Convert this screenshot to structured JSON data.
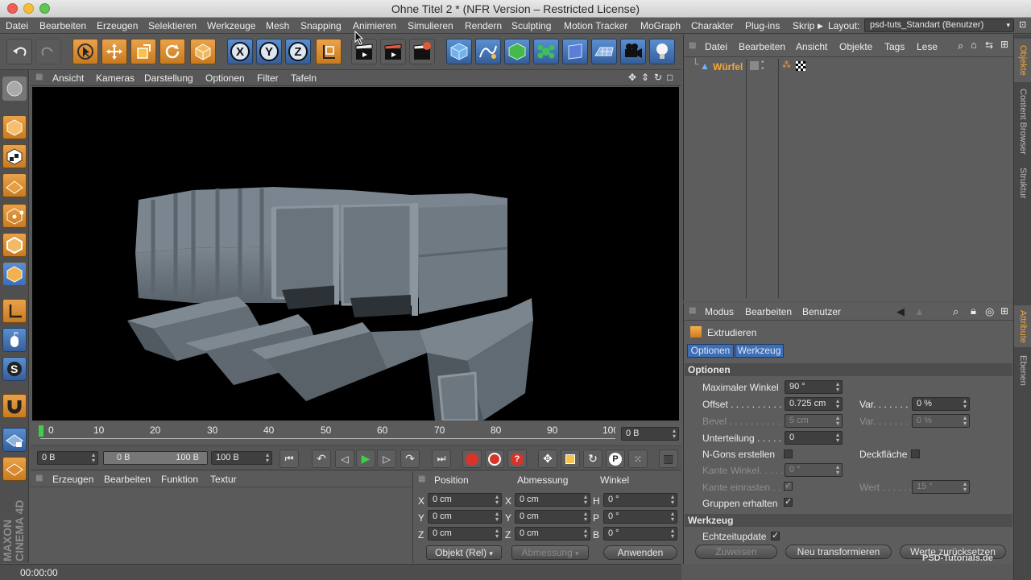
{
  "window": {
    "title": "Ohne Titel 2 * (NFR Version – Restricted License)"
  },
  "menubar": {
    "items": [
      "Datei",
      "Bearbeiten",
      "Erzeugen",
      "Selektieren",
      "Werkzeuge",
      "Mesh",
      "Snapping",
      "Animieren",
      "Simulieren",
      "Rendern",
      "Sculpting",
      "Motion Tracker",
      "MoGraph",
      "Charakter",
      "Plug-ins",
      "Skrip"
    ],
    "layout_label": "Layout:",
    "layout_value": "psd-tuts_Standart (Benutzer)"
  },
  "toolbar": {
    "axis_x": "X",
    "axis_y": "Y",
    "axis_z": "Z"
  },
  "viewport": {
    "menu": [
      "Ansicht",
      "Kameras",
      "Darstellung",
      "Optionen",
      "Filter",
      "Tafeln"
    ]
  },
  "timeline": {
    "ticks": [
      "0",
      "10",
      "20",
      "30",
      "40",
      "50",
      "60",
      "70",
      "80",
      "90",
      "100"
    ],
    "current_frame": "0 B"
  },
  "transport": {
    "start_field": "0 B",
    "range_start": "0 B",
    "range_end": "100 B",
    "end_field": "100 B"
  },
  "materials": {
    "menu": [
      "Erzeugen",
      "Bearbeiten",
      "Funktion",
      "Textur"
    ]
  },
  "coordinates": {
    "headers": [
      "Position",
      "Abmessung",
      "Winkel"
    ],
    "rows": [
      {
        "axis": "X",
        "pos": "0 cm",
        "dim_axis": "X",
        "dim": "0 cm",
        "angle_axis": "H",
        "angle": "0 °"
      },
      {
        "axis": "Y",
        "pos": "0 cm",
        "dim_axis": "Y",
        "dim": "0 cm",
        "angle_axis": "P",
        "angle": "0 °"
      },
      {
        "axis": "Z",
        "pos": "0 cm",
        "dim_axis": "Z",
        "dim": "0 cm",
        "angle_axis": "B",
        "angle": "0 °"
      }
    ],
    "mode": "Objekt (Rel)",
    "size_mode": "Abmessung",
    "apply": "Anwenden"
  },
  "status": {
    "time": "00:00:00"
  },
  "objects": {
    "menu": [
      "Datei",
      "Bearbeiten",
      "Ansicht",
      "Objekte",
      "Tags",
      "Lese"
    ],
    "items": [
      {
        "name": "Würfel"
      }
    ]
  },
  "attributes": {
    "menu": [
      "Modus",
      "Bearbeiten",
      "Benutzer"
    ],
    "tool_name": "Extrudieren",
    "tabs": [
      "Optionen",
      "Werkzeug"
    ],
    "section_options": "Optionen",
    "max_angle_label": "Maximaler Winkel",
    "max_angle": "90 °",
    "offset_label": "Offset . . . . . . . . . . .",
    "offset": "0.725 cm",
    "var_label": "Var. . . . . . .",
    "var": "0 %",
    "bevel_label": "Bevel . . . . . . . . . . .",
    "bevel": "5 cm",
    "var2_label": "Var. . . . . . .",
    "var2": "0 %",
    "subdiv_label": "Unterteilung . . . . .",
    "subdiv": "0",
    "ngons_label": "N-Gons erstellen",
    "cap_label": "Deckfläche",
    "edge_angle_label": "Kante Winkel. . . . .",
    "edge_angle": "0 °",
    "edge_snap_label": "Kante einrasten . .",
    "value_label": "Wert . . . . . .",
    "value": "15 °",
    "keep_groups_label": "Gruppen erhalten",
    "section_tool": "Werkzeug",
    "realtime_label": "Echtzeitupdate",
    "btn_assign": "Zuweisen",
    "btn_new": "Neu transformieren",
    "btn_reset": "Werte zurücksetzen"
  },
  "side_tabs": [
    "Objekte",
    "Content Browser",
    "Struktur",
    "Attribute",
    "Ebenen"
  ],
  "branding": {
    "c4d": "MAXON CINEMA 4D",
    "watermark": "PSD-Tutorials.de"
  },
  "colors": {
    "accent_orange": "#e89a36",
    "accent_blue": "#4d83c8",
    "select_blue": "#3d6fb8"
  }
}
